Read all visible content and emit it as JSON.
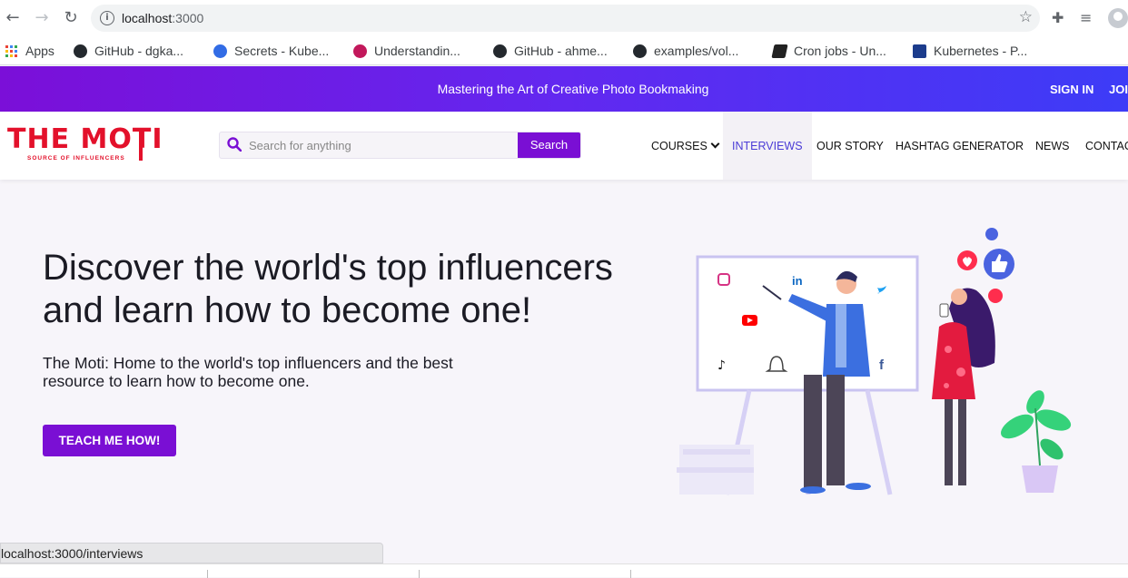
{
  "browser": {
    "url_host": "localhost",
    "url_port": ":3000",
    "bookmarks": [
      {
        "label": "Apps",
        "icon": "apps-grid-icon"
      },
      {
        "label": "GitHub - dgka...",
        "icon": "github-icon"
      },
      {
        "label": "Secrets - Kube...",
        "icon": "kubernetes-icon"
      },
      {
        "label": "Understandin...",
        "icon": "ring-icon"
      },
      {
        "label": "GitHub - ahme...",
        "icon": "github-icon"
      },
      {
        "label": "examples/vol...",
        "icon": "github-icon"
      },
      {
        "label": "Cron jobs - Un...",
        "icon": "book-icon"
      },
      {
        "label": "Kubernetes - P...",
        "icon": "blue-square-icon"
      }
    ],
    "status_url": "localhost:3000/interviews"
  },
  "announcement": {
    "message": "Mastering the Art of Creative Photo Bookmaking",
    "signin": "SIGN IN",
    "join": "JOIN"
  },
  "header": {
    "logo_word": "THE MOTI",
    "logo_tagline": "SOURCE OF INFLUENCERS",
    "search_placeholder": "Search for anything",
    "search_button": "Search",
    "menu": [
      "COURSES",
      "INTERVIEWS",
      "OUR STORY",
      "HASHTAG GENERATOR",
      "NEWS",
      "CONTACT"
    ],
    "active_menu": "INTERVIEWS"
  },
  "hero": {
    "title": "Discover the world's top influencers and learn how to become one!",
    "subtitle": "The Moti: Home to the world's top influencers and the best resource to learn how to become one.",
    "cta": "TEACH ME HOW!"
  },
  "colors": {
    "brand_purple": "#7a0fd4",
    "logo_red": "#e3112b",
    "active_menu": "#4a3bd6"
  }
}
